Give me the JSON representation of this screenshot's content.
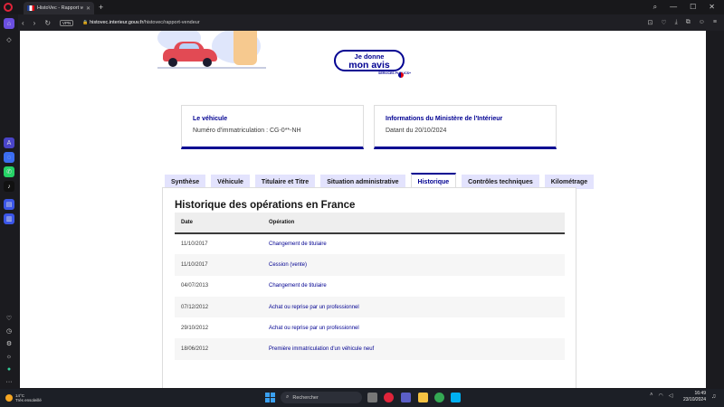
{
  "browser": {
    "tab_title": "HistoVec - Rapport vende",
    "url_host": "histovec.interieur.gouv.fr",
    "url_path": "/histovec/rapport-vendeur",
    "vpn_label": "VPN"
  },
  "hero": {
    "button_line1": "Je donne",
    "button_line2": "mon avis",
    "services_publics": "SERVICES PUBLICS+"
  },
  "cards": {
    "vehicle_label": "Le véhicule",
    "vehicle_value": "Numéro d'immatriculation : CG-0**-NH",
    "ministry_label": "Informations du Ministère de l'Intérieur",
    "ministry_value": "Datant du 20/10/2024"
  },
  "tabs": [
    "Synthèse",
    "Véhicule",
    "Titulaire et Titre",
    "Situation administrative",
    "Historique",
    "Contrôles techniques",
    "Kilométrage"
  ],
  "history": {
    "title": "Historique des opérations en France",
    "col_date": "Date",
    "col_operation": "Opération",
    "rows": [
      {
        "date": "11/10/2017",
        "operation": "Changement de titulaire"
      },
      {
        "date": "11/10/2017",
        "operation": "Cession (vente)"
      },
      {
        "date": "04/07/2013",
        "operation": "Changement de titulaire"
      },
      {
        "date": "07/12/2012",
        "operation": "Achat ou reprise par un professionnel"
      },
      {
        "date": "29/10/2012",
        "operation": "Achat ou reprise par un professionnel"
      },
      {
        "date": "18/06/2012",
        "operation": "Première immatriculation d'un véhicule neuf"
      }
    ]
  },
  "taskbar": {
    "temp": "14°C",
    "weather": "Très ensoleillé",
    "search_placeholder": "Rechercher",
    "time": "16:49",
    "date": "23/10/2024"
  }
}
